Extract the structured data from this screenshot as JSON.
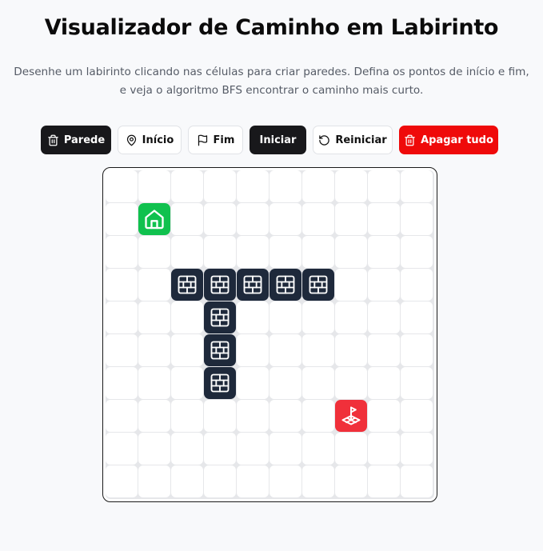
{
  "header": {
    "title": "Visualizador de Caminho em Labirinto",
    "description_line1": "Desenhe um labirinto clicando nas células para criar paredes. Defina os pontos de início e fim,",
    "description_line2": "e veja o algoritmo BFS encontrar o caminho mais curto."
  },
  "toolbar": {
    "wall_label": "Parede",
    "start_label": "Início",
    "end_label": "Fim",
    "run_label": "Iniciar",
    "reset_label": "Reiniciar",
    "clear_label": "Apagar tudo"
  },
  "icons": {
    "wall": "trash-icon",
    "start": "map-pin-icon",
    "end": "flag-icon",
    "reset": "rotate-ccw-icon",
    "clear": "trash-icon",
    "wall_cell": "brick-wall-icon",
    "start_cell": "house-icon",
    "end_cell": "flag-tile-icon"
  },
  "colors": {
    "dark": "#18181b",
    "wall": "#1e293b",
    "start": "#10c14e",
    "end": "#f0303a",
    "danger": "#ef0a0a"
  },
  "maze": {
    "rows": 10,
    "cols": 10,
    "start": [
      1,
      1
    ],
    "end": [
      7,
      7
    ],
    "walls": [
      [
        3,
        2
      ],
      [
        3,
        3
      ],
      [
        3,
        4
      ],
      [
        3,
        5
      ],
      [
        3,
        6
      ],
      [
        4,
        3
      ],
      [
        5,
        3
      ],
      [
        6,
        3
      ]
    ]
  }
}
